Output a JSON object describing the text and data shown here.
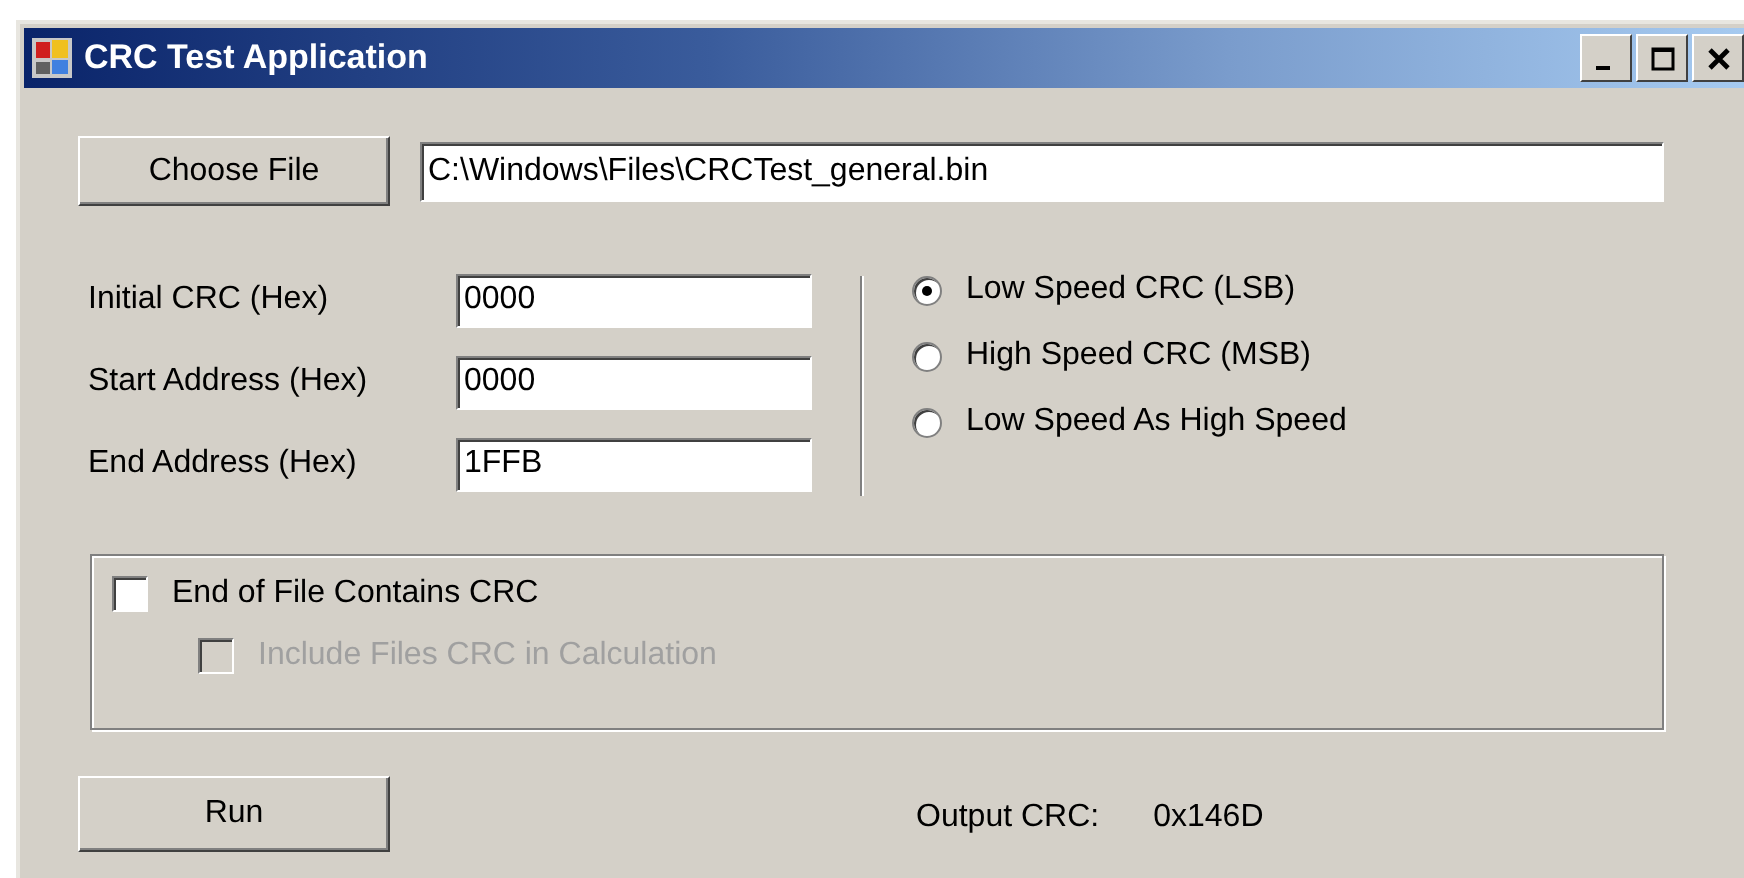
{
  "window": {
    "title": "CRC Test Application"
  },
  "file": {
    "button": "Choose File",
    "path": "C:\\Windows\\Files\\CRCTest_general.bin"
  },
  "fields": [
    {
      "label": "Initial CRC (Hex)",
      "value": "0000"
    },
    {
      "label": "Start Address (Hex)",
      "value": "0000"
    },
    {
      "label": "End Address (Hex)",
      "value": "1FFB"
    }
  ],
  "modes": [
    {
      "label": "Low Speed CRC (LSB)",
      "selected": true
    },
    {
      "label": "High Speed CRC (MSB)",
      "selected": false
    },
    {
      "label": "Low Speed As High Speed",
      "selected": false
    }
  ],
  "options": [
    {
      "label": "End of File Contains CRC",
      "checked": false,
      "disabled": false,
      "children": [
        {
          "label": "Include Files CRC in Calculation",
          "checked": false,
          "disabled": true
        }
      ]
    }
  ],
  "run_button": "Run",
  "output": {
    "label": "Output CRC:",
    "value": "0x146D"
  }
}
